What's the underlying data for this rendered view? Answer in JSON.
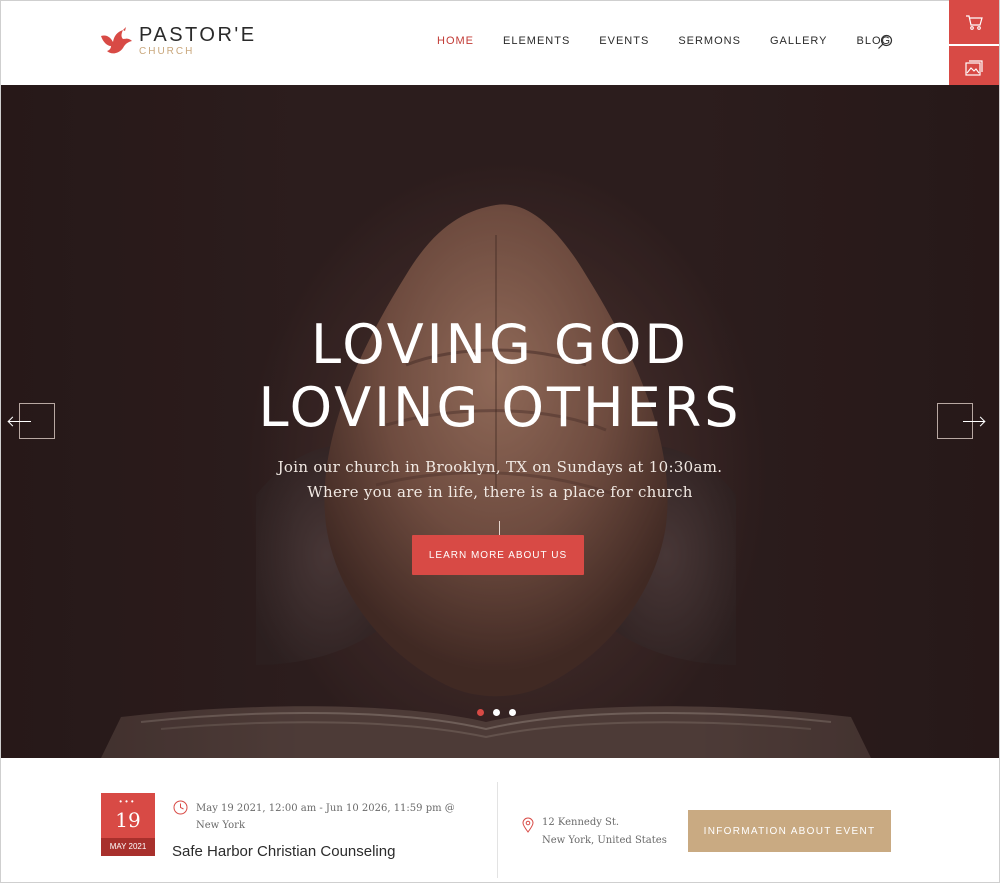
{
  "brand": {
    "name": "PASTOR'E",
    "tagline": "CHURCH",
    "accent_color": "#d84a45",
    "gold_color": "#c9aa82"
  },
  "nav": {
    "items": [
      {
        "label": "HOME",
        "active": true
      },
      {
        "label": "ELEMENTS",
        "active": false
      },
      {
        "label": "EVENTS",
        "active": false
      },
      {
        "label": "SERMONS",
        "active": false
      },
      {
        "label": "GALLERY",
        "active": false
      },
      {
        "label": "BLOG",
        "active": false
      }
    ],
    "search_icon": "search-icon"
  },
  "side_panel": {
    "icons": [
      "cart-icon",
      "image-gallery-icon",
      "browser-window-icon"
    ]
  },
  "hero": {
    "title_line1": "LOVING GOD",
    "title_line2": "LOVING OTHERS",
    "subtitle_line1": "Join our church in Brooklyn, TX on Sundays at 10:30am.",
    "subtitle_line2": "Where you are in life, there is a place for church",
    "cta_label": "LEARN MORE ABOUT US",
    "slides": 3,
    "active_slide": 1
  },
  "event": {
    "day": "19",
    "month": "MAY 2021",
    "time_range": "May 19 2021, 12:00 am - Jun 10 2026, 11:59 pm @ New York",
    "title": "Safe Harbor Christian Counseling",
    "address_line1": "12 Kennedy St.",
    "address_line2": "New York, United States",
    "button_label": "INFORMATION ABOUT EVENT"
  }
}
